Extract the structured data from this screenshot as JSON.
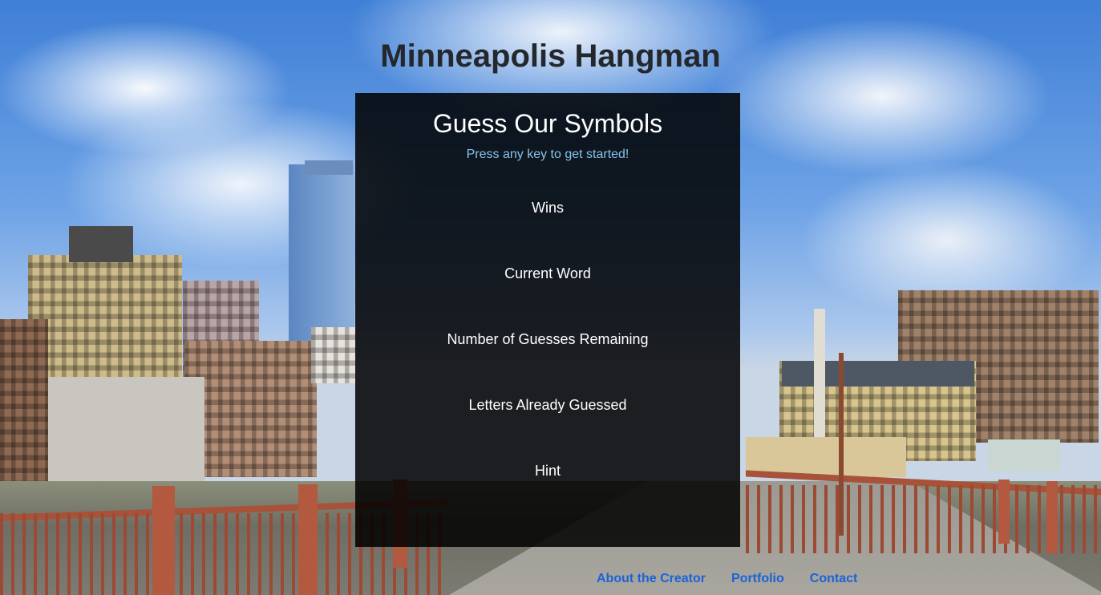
{
  "page": {
    "title": "Minneapolis Hangman"
  },
  "game": {
    "heading": "Guess Our Symbols",
    "instruction": "Press any key to get started!",
    "stats": [
      {
        "label": "Wins"
      },
      {
        "label": "Current Word"
      },
      {
        "label": "Number of Guesses Remaining"
      },
      {
        "label": "Letters Already Guessed"
      },
      {
        "label": "Hint"
      }
    ]
  },
  "footer": {
    "links": [
      {
        "label": "About the Creator"
      },
      {
        "label": "Portfolio"
      },
      {
        "label": "Contact"
      }
    ]
  },
  "colors": {
    "title": "#24282c",
    "panel_background": "rgba(0,0,0,0.86)",
    "instruction": "#86c3e8",
    "link": "#1c63d6"
  }
}
